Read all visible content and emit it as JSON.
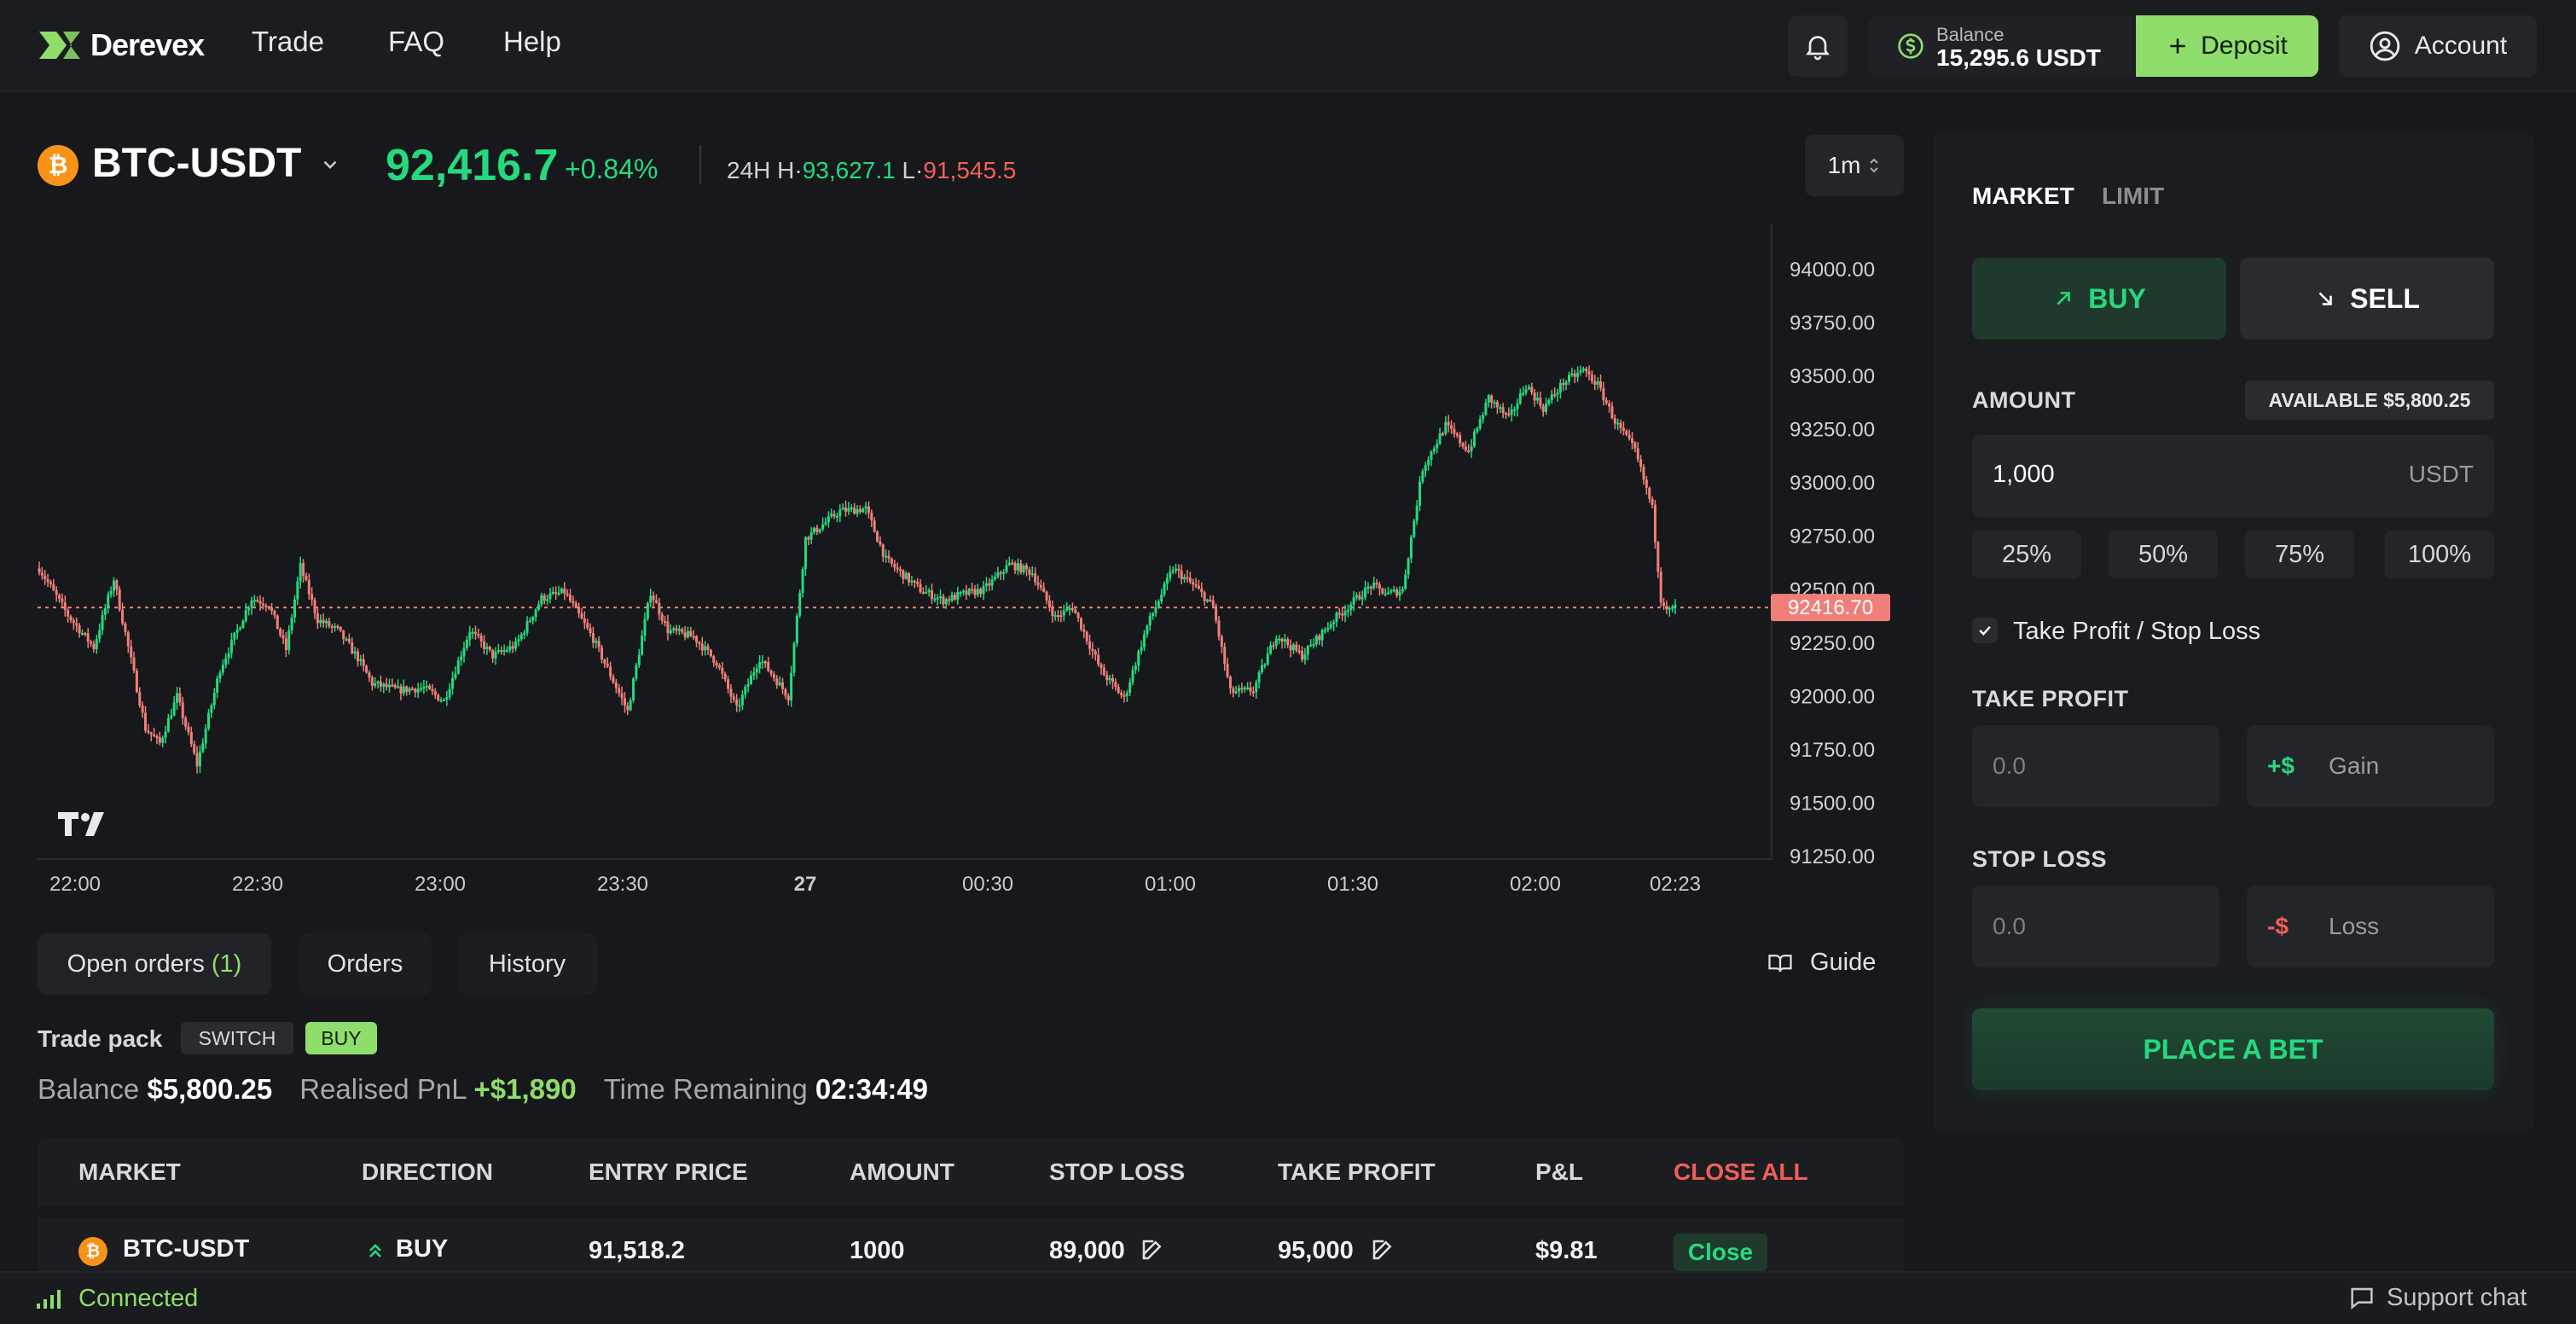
{
  "nav": {
    "brand": "Derevex",
    "links": [
      "Trade",
      "FAQ",
      "Help"
    ],
    "balance_label": "Balance",
    "balance_value": "15,295.6 USDT",
    "deposit_label": "Deposit",
    "account_label": "Account"
  },
  "ticker": {
    "symbol": "BTC-USDT",
    "price": "92,416.7",
    "change": "+0.84%",
    "range_prefix": "24H H·",
    "high": "93,627.1",
    "low_prefix": " L·",
    "low": "91,545.5",
    "interval": "1m"
  },
  "chart_data": {
    "type": "candlestick",
    "y_ticks": [
      "94000.00",
      "93750.00",
      "93500.00",
      "93250.00",
      "93000.00",
      "92750.00",
      "92500.00",
      "92250.00",
      "92000.00",
      "91750.00",
      "91500.00",
      "91250.00"
    ],
    "ylim": [
      91250,
      94000
    ],
    "x_ticks": [
      "22:00",
      "22:30",
      "23:00",
      "23:30",
      "27",
      "00:30",
      "01:00",
      "01:30",
      "02:00",
      "02:23"
    ],
    "last_price": 92416.7,
    "last_price_label": "92416.70",
    "colors": {
      "up": "#26d97f",
      "down": "#f07f79"
    },
    "close_path": [
      [
        0,
        92600
      ],
      [
        10,
        92380
      ],
      [
        19,
        92230
      ],
      [
        26,
        92550
      ],
      [
        37,
        91850
      ],
      [
        42,
        91780
      ],
      [
        48,
        92000
      ],
      [
        55,
        91680
      ],
      [
        63,
        92130
      ],
      [
        74,
        92460
      ],
      [
        80,
        92430
      ],
      [
        86,
        92220
      ],
      [
        91,
        92610
      ],
      [
        97,
        92360
      ],
      [
        104,
        92310
      ],
      [
        111,
        92180
      ],
      [
        116,
        92060
      ],
      [
        125,
        92030
      ],
      [
        134,
        92040
      ],
      [
        141,
        91980
      ],
      [
        150,
        92310
      ],
      [
        158,
        92190
      ],
      [
        166,
        92240
      ],
      [
        175,
        92460
      ],
      [
        183,
        92490
      ],
      [
        193,
        92270
      ],
      [
        205,
        91930
      ],
      [
        213,
        92490
      ],
      [
        219,
        92310
      ],
      [
        228,
        92280
      ],
      [
        236,
        92160
      ],
      [
        243,
        91940
      ],
      [
        251,
        92180
      ],
      [
        261,
        92000
      ],
      [
        267,
        92740
      ],
      [
        279,
        92870
      ],
      [
        288,
        92880
      ],
      [
        295,
        92640
      ],
      [
        307,
        92500
      ],
      [
        315,
        92450
      ],
      [
        322,
        92480
      ],
      [
        329,
        92500
      ],
      [
        338,
        92620
      ],
      [
        346,
        92580
      ],
      [
        354,
        92370
      ],
      [
        360,
        92420
      ],
      [
        370,
        92120
      ],
      [
        378,
        91990
      ],
      [
        386,
        92330
      ],
      [
        395,
        92600
      ],
      [
        403,
        92510
      ],
      [
        409,
        92420
      ],
      [
        415,
        92020
      ],
      [
        423,
        92030
      ],
      [
        431,
        92290
      ],
      [
        440,
        92190
      ],
      [
        451,
        92360
      ],
      [
        464,
        92520
      ],
      [
        470,
        92480
      ],
      [
        475,
        92500
      ],
      [
        482,
        93070
      ],
      [
        490,
        93270
      ],
      [
        498,
        93150
      ],
      [
        505,
        93400
      ],
      [
        512,
        93300
      ],
      [
        518,
        93460
      ],
      [
        524,
        93350
      ],
      [
        531,
        93470
      ],
      [
        538,
        93530
      ],
      [
        543,
        93460
      ],
      [
        549,
        93290
      ],
      [
        556,
        93150
      ],
      [
        562,
        92880
      ],
      [
        565,
        92460
      ],
      [
        568,
        92400
      ],
      [
        570,
        92420
      ]
    ],
    "noise": 0.17
  },
  "order_panel": {
    "tabs": [
      "MARKET",
      "LIMIT"
    ],
    "buy_label": "BUY",
    "sell_label": "SELL",
    "amount_label": "AMOUNT",
    "available_label": "AVAILABLE $5,800.25",
    "amount_value": "1,000",
    "amount_unit": "USDT",
    "percent_options": [
      "25%",
      "50%",
      "75%",
      "100%"
    ],
    "tpsl_label": "Take Profit / Stop Loss",
    "take_profit_label": "TAKE PROFIT",
    "tp_placeholder": "0.0",
    "tp_prefix": "+$",
    "tp_suffix": "Gain",
    "stop_loss_label": "STOP LOSS",
    "sl_placeholder": "0.0",
    "sl_prefix": "-$",
    "sl_suffix": "Loss",
    "submit_label": "PLACE A BET"
  },
  "bottom": {
    "tabs": [
      "Open orders",
      "Orders",
      "History"
    ],
    "open_count": "(1)",
    "guide_label": "Guide",
    "trade_pack_label": "Trade pack",
    "switch_badge": "SWITCH",
    "buy_badge": "BUY",
    "balance_label": "Balance",
    "balance_value": "$5,800.25",
    "pnl_label": "Realised PnL",
    "pnl_value": "+$1,890",
    "time_label": "Time Remaining",
    "time_value": "02:34:49",
    "columns": [
      "MARKET",
      "DIRECTION",
      "ENTRY PRICE",
      "AMOUNT",
      "STOP LOSS",
      "TAKE PROFIT",
      "P&L",
      "CLOSE ALL"
    ],
    "row": {
      "market": "BTC-USDT",
      "direction": "BUY",
      "entry_price": "91,518.2",
      "amount": "1000",
      "stop_loss": "89,000",
      "take_profit": "95,000",
      "pnl": "$9.81",
      "close_label": "Close"
    }
  },
  "status": {
    "connection": "Connected",
    "support": "Support chat"
  }
}
